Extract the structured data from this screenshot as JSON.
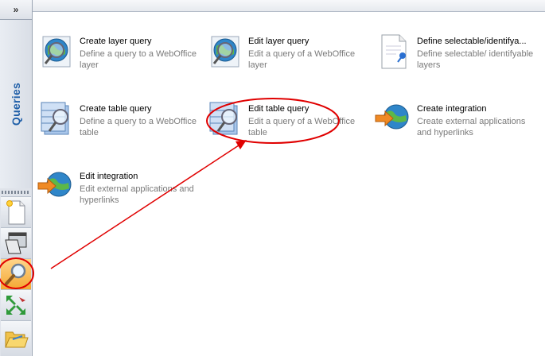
{
  "sidebar": {
    "collapse_label": "»",
    "tab_label": "Queries",
    "tools": [
      {
        "name": "new-document-icon"
      },
      {
        "name": "open-window-icon"
      },
      {
        "name": "magnifier-icon"
      },
      {
        "name": "move-arrows-icon"
      },
      {
        "name": "open-folder-icon"
      }
    ]
  },
  "items": [
    {
      "title": "Create layer query",
      "desc": "Define a query to a WebOffice layer",
      "icon": "globe-magnifier-icon"
    },
    {
      "title": "Edit layer query",
      "desc": "Edit a query of a WebOffice layer",
      "icon": "globe-magnifier-icon"
    },
    {
      "title": "Define selectable/identifya...",
      "desc": "Define selectable/ identifyable layers",
      "icon": "document-pin-icon"
    },
    {
      "title": "Create table query",
      "desc": "Define a query to a WebOffice table",
      "icon": "table-magnifier-icon"
    },
    {
      "title": "Edit table query",
      "desc": "Edit a query of a WebOffice table",
      "icon": "table-magnifier-icon"
    },
    {
      "title": "Create integration",
      "desc": "Create external applications and hyperlinks",
      "icon": "globe-arrow-icon"
    },
    {
      "title": "Edit integration",
      "desc": "Edit external applications and hyperlinks",
      "icon": "globe-arrow-icon"
    }
  ],
  "colors": {
    "annotation": "#e00000",
    "tab_text": "#1f5fa8"
  }
}
